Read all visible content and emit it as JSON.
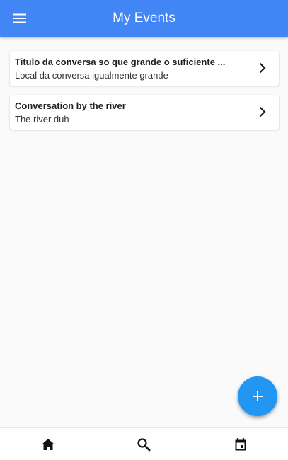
{
  "app_bar": {
    "title": "My Events",
    "menu_icon": "menu-icon",
    "background": "#4285f4"
  },
  "events": [
    {
      "title": "Titulo da conversa so que grande o suficiente ...",
      "location": "Local da conversa igualmente grande",
      "icon": "chevron-right-icon"
    },
    {
      "title": "Conversation by the river",
      "location": "The river duh",
      "icon": "chevron-right-icon"
    }
  ],
  "fab": {
    "icon": "add-icon",
    "color": "#2196f3"
  },
  "bottom_nav": {
    "items": [
      {
        "icon": "home-icon"
      },
      {
        "icon": "search-icon"
      },
      {
        "icon": "calendar-icon"
      }
    ]
  }
}
